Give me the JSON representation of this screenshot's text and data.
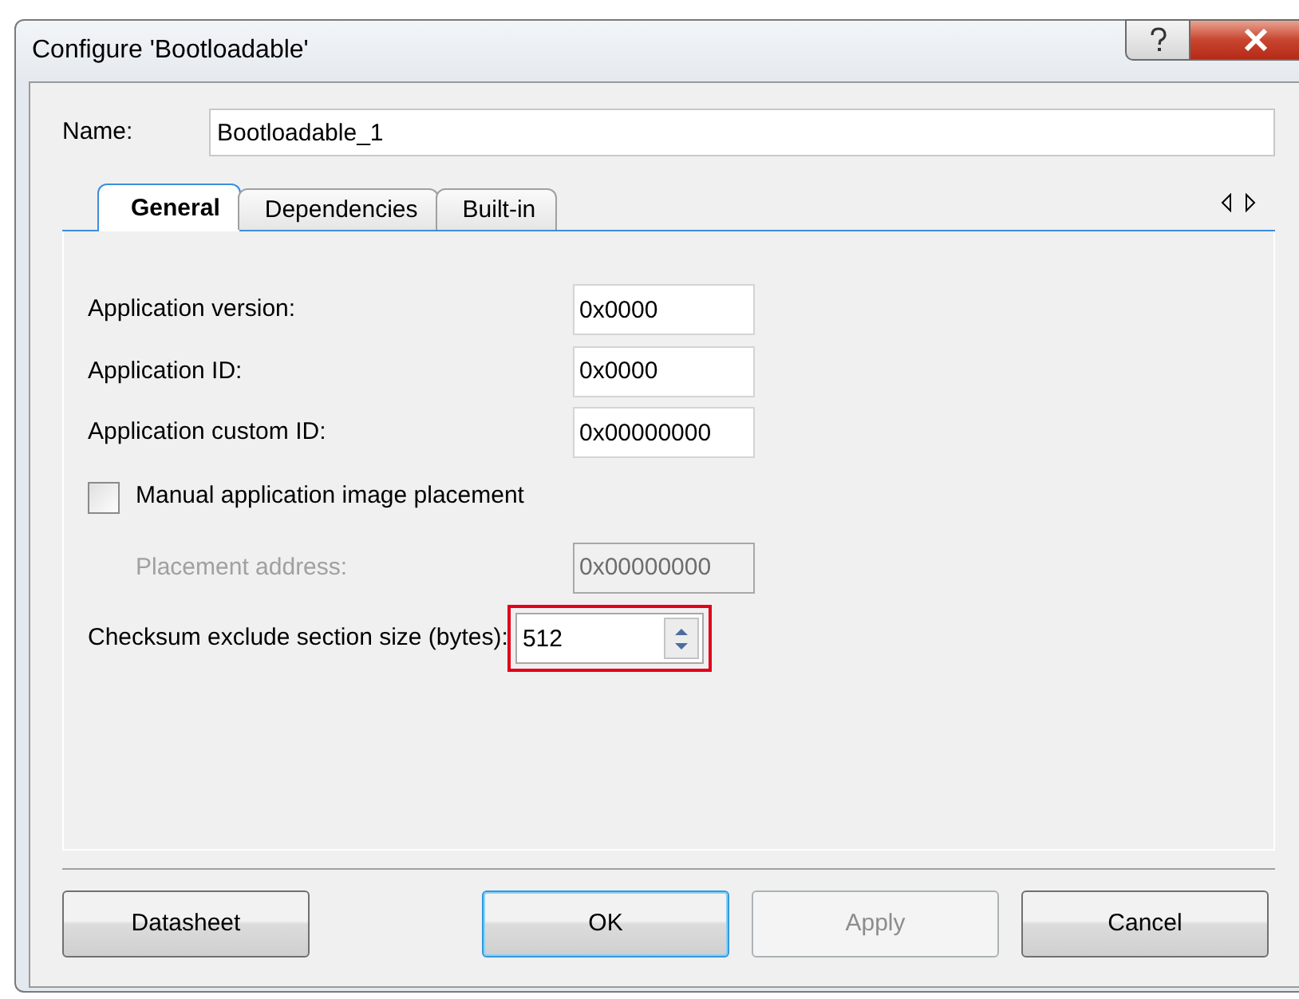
{
  "window": {
    "title": "Configure 'Bootloadable'"
  },
  "name_field": {
    "label": "Name:",
    "value": "Bootloadable_1"
  },
  "tabs": [
    {
      "label": "General",
      "selected": true
    },
    {
      "label": "Dependencies",
      "selected": false
    },
    {
      "label": "Built-in",
      "selected": false
    }
  ],
  "fields": [
    {
      "kind": "text",
      "label": "Application version:",
      "value": "0x0000",
      "disabled": false
    },
    {
      "kind": "text",
      "label": "Application ID:",
      "value": "0x0000",
      "disabled": false
    },
    {
      "kind": "text",
      "label": "Application custom ID:",
      "value": "0x00000000",
      "disabled": false
    },
    {
      "kind": "checkbox",
      "label": "Manual application image placement",
      "checked": false
    },
    {
      "kind": "text",
      "label": "Placement address:",
      "value": "0x00000000",
      "disabled": true
    },
    {
      "kind": "spin",
      "label": "Checksum exclude section size (bytes):",
      "value": "512",
      "highlighted": true
    }
  ],
  "buttons": [
    {
      "label": "Datasheet",
      "default": false,
      "disabled": false
    },
    {
      "label": "OK",
      "default": true,
      "disabled": false
    },
    {
      "label": "Apply",
      "default": false,
      "disabled": true
    },
    {
      "label": "Cancel",
      "default": false,
      "disabled": false
    }
  ]
}
